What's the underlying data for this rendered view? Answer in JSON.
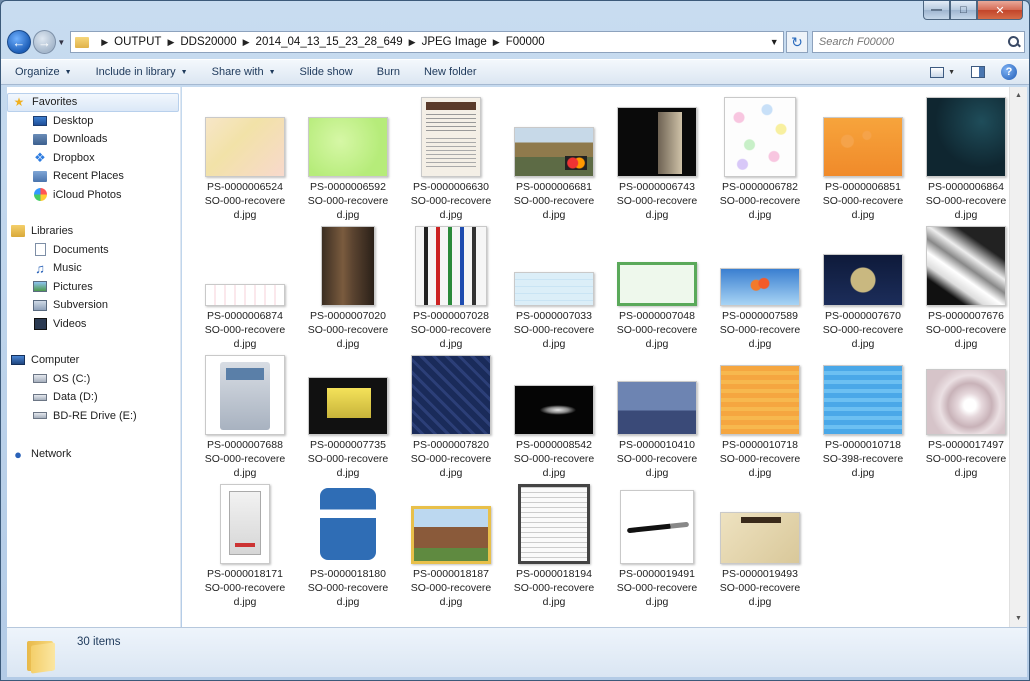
{
  "address": {
    "crumbs": [
      "OUTPUT",
      "DDS20000",
      "2014_04_13_15_23_28_649",
      "JPEG Image",
      "F00000"
    ],
    "search_placeholder": "Search F00000"
  },
  "toolbar": {
    "organize": "Organize",
    "include_in_library": "Include in library",
    "share_with": "Share with",
    "slide_show": "Slide show",
    "burn": "Burn",
    "new_folder": "New folder"
  },
  "nav": {
    "favorites": "Favorites",
    "favorites_items": [
      "Desktop",
      "Downloads",
      "Dropbox",
      "Recent Places",
      "iCloud Photos"
    ],
    "libraries": "Libraries",
    "libraries_items": [
      "Documents",
      "Music",
      "Pictures",
      "Subversion",
      "Videos"
    ],
    "computer": "Computer",
    "computer_items": [
      "OS (C:)",
      "Data (D:)",
      "BD-RE Drive (E:)"
    ],
    "network": "Network"
  },
  "files": [
    {
      "l1": "PS-0000006524",
      "l2": "SO-000-recovere",
      "l3": "d.jpg"
    },
    {
      "l1": "PS-0000006592",
      "l2": "SO-000-recovere",
      "l3": "d.jpg"
    },
    {
      "l1": "PS-0000006630",
      "l2": "SO-000-recovere",
      "l3": "d.jpg"
    },
    {
      "l1": "PS-0000006681",
      "l2": "SO-000-recovere",
      "l3": "d.jpg"
    },
    {
      "l1": "PS-0000006743",
      "l2": "SO-000-recovere",
      "l3": "d.jpg"
    },
    {
      "l1": "PS-0000006782",
      "l2": "SO-000-recovere",
      "l3": "d.jpg"
    },
    {
      "l1": "PS-0000006851",
      "l2": "SO-000-recovere",
      "l3": "d.jpg"
    },
    {
      "l1": "PS-0000006864",
      "l2": "SO-000-recovere",
      "l3": "d.jpg"
    },
    {
      "l1": "PS-0000006874",
      "l2": "SO-000-recovere",
      "l3": "d.jpg"
    },
    {
      "l1": "PS-0000007020",
      "l2": "SO-000-recovere",
      "l3": "d.jpg"
    },
    {
      "l1": "PS-0000007028",
      "l2": "SO-000-recovere",
      "l3": "d.jpg"
    },
    {
      "l1": "PS-0000007033",
      "l2": "SO-000-recovere",
      "l3": "d.jpg"
    },
    {
      "l1": "PS-0000007048",
      "l2": "SO-000-recovere",
      "l3": "d.jpg"
    },
    {
      "l1": "PS-0000007589",
      "l2": "SO-000-recovere",
      "l3": "d.jpg"
    },
    {
      "l1": "PS-0000007670",
      "l2": "SO-000-recovere",
      "l3": "d.jpg"
    },
    {
      "l1": "PS-0000007676",
      "l2": "SO-000-recovere",
      "l3": "d.jpg"
    },
    {
      "l1": "PS-0000007688",
      "l2": "SO-000-recovere",
      "l3": "d.jpg"
    },
    {
      "l1": "PS-0000007735",
      "l2": "SO-000-recovere",
      "l3": "d.jpg"
    },
    {
      "l1": "PS-0000007820",
      "l2": "SO-000-recovere",
      "l3": "d.jpg"
    },
    {
      "l1": "PS-0000008542",
      "l2": "SO-000-recovere",
      "l3": "d.jpg"
    },
    {
      "l1": "PS-0000010410",
      "l2": "SO-000-recovere",
      "l3": "d.jpg"
    },
    {
      "l1": "PS-0000010718",
      "l2": "SO-000-recovere",
      "l3": "d.jpg"
    },
    {
      "l1": "PS-0000010718",
      "l2": "SO-398-recovere",
      "l3": "d.jpg"
    },
    {
      "l1": "PS-0000017497",
      "l2": "SO-000-recovere",
      "l3": "d.jpg"
    },
    {
      "l1": "PS-0000018171",
      "l2": "SO-000-recovere",
      "l3": "d.jpg"
    },
    {
      "l1": "PS-0000018180",
      "l2": "SO-000-recovere",
      "l3": "d.jpg"
    },
    {
      "l1": "PS-0000018187",
      "l2": "SO-000-recovere",
      "l3": "d.jpg"
    },
    {
      "l1": "PS-0000018194",
      "l2": "SO-000-recovere",
      "l3": "d.jpg"
    },
    {
      "l1": "PS-0000019491",
      "l2": "SO-000-recovere",
      "l3": "d.jpg"
    },
    {
      "l1": "PS-0000019493",
      "l2": "SO-000-recovere",
      "l3": "d.jpg"
    }
  ],
  "status": {
    "item_count": "30 items"
  }
}
